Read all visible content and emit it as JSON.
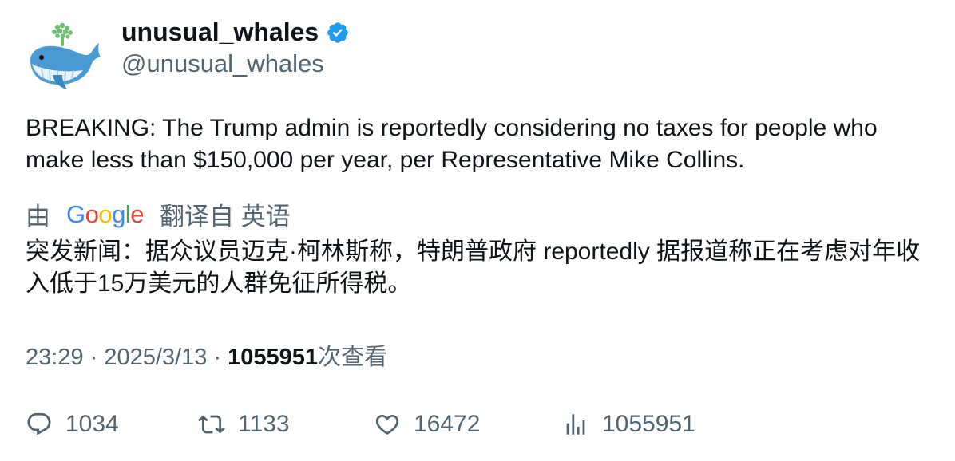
{
  "author": {
    "display_name": "unusual_whales",
    "handle": "@unusual_whales",
    "verified": true,
    "verified_color": "#1d9bf0",
    "avatar_icon": "whale-icon"
  },
  "tweet": {
    "text": "BREAKING: The Trump admin is reportedly considering no taxes for people who make less than $150,000 per year, per Representative Mike Collins."
  },
  "translation": {
    "prefix": "由",
    "provider": "Google",
    "suffix": "翻译自 英语",
    "text": "突发新闻：据众议员迈克·柯林斯称，特朗普政府 reportedly 据报道称正在考虑对年收入低于15万美元的人群免征所得税。"
  },
  "meta": {
    "time": "23:29",
    "separator": "·",
    "date": "2025/3/13",
    "views_count": "1055951",
    "views_label": "次查看"
  },
  "actions": {
    "reply_count": "1034",
    "retweet_count": "1133",
    "like_count": "16472",
    "views_count": "1055951"
  },
  "colors": {
    "text_primary": "#0f1419",
    "text_secondary": "#536471",
    "accent": "#1d9bf0"
  }
}
